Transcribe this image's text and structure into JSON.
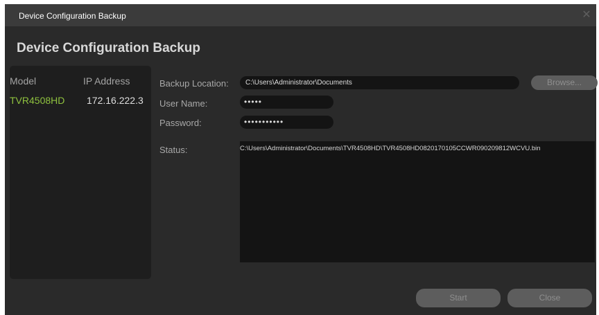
{
  "window": {
    "title": "Device Configuration Backup"
  },
  "header": {
    "title": "Device Configuration Backup"
  },
  "device_list": {
    "columns": [
      "Model",
      "IP Address"
    ],
    "rows": [
      {
        "model": "TVR4508HD",
        "ip": "172.16.222.3",
        "model_color": "#8fc23f"
      }
    ]
  },
  "form": {
    "backup_location_label": "Backup Location:",
    "backup_location_value": "C:\\Users\\Administrator\\Documents",
    "browse_label": "Browse...",
    "username_label": "User Name:",
    "username_value": "•••••",
    "password_label": "Password:",
    "password_value": "•••••••••••",
    "status_label": "Status:",
    "status_value": "C:\\Users\\Administrator\\Documents\\TVR4508HD\\TVR4508HD0820170105CCWR090209812WCVU.bin"
  },
  "footer": {
    "start_label": "Start",
    "close_label": "Close"
  },
  "colors": {
    "window_bg": "#2a2a2a",
    "titlebar_bg": "#3b3b3b",
    "accent_green": "#8fc23f",
    "button_bg": "#5d5d5d"
  }
}
